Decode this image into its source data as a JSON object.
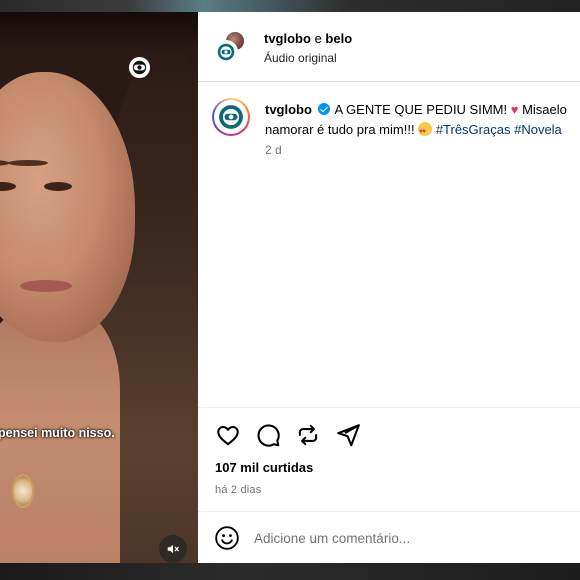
{
  "header": {
    "user1": "tvglobo",
    "connector": "e",
    "user2": "belo",
    "audio": "Áudio original"
  },
  "video": {
    "caption": "pensei muito nisso."
  },
  "post": {
    "username": "tvglobo",
    "text1": "A GENTE QUE PEDIU SIMM!",
    "text2": "Misaelo",
    "text3": "namorar é tudo pra mim!!!",
    "hashtag1": "#TrêsGraças",
    "hashtag2": "#Novela",
    "time": "2 d"
  },
  "actions": {
    "likes": "107 mil curtidas",
    "ago": "há 2 dias"
  },
  "comment": {
    "placeholder": "Adicione um comentário..."
  },
  "colors": {
    "verified": "#0095f6",
    "hashtag": "#00376b",
    "muted_text": "#737373"
  }
}
